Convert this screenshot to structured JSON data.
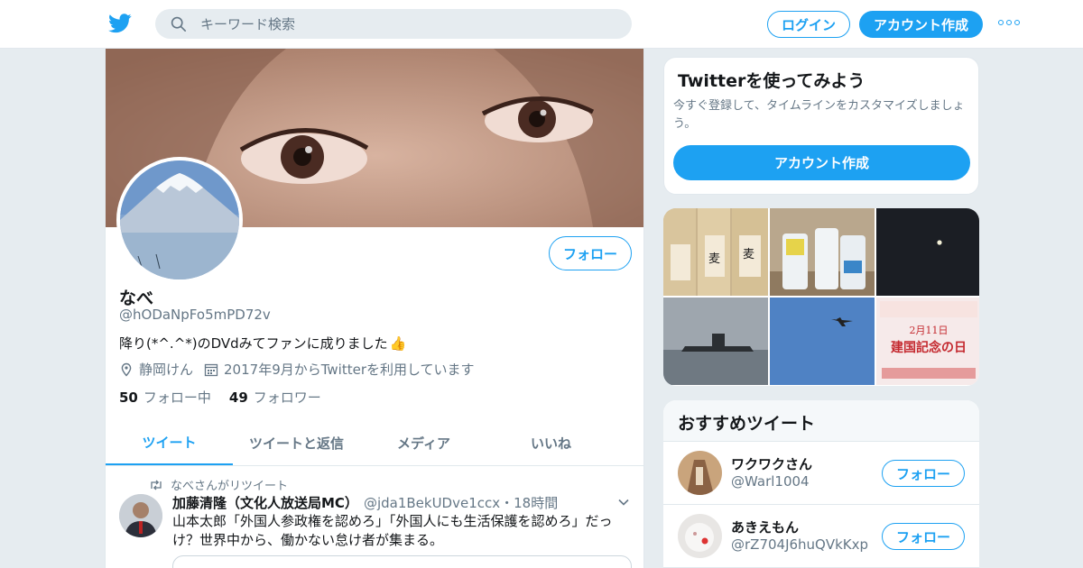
{
  "nav": {
    "search_placeholder": "キーワード検索",
    "login_label": "ログイン",
    "signup_label": "アカウント作成"
  },
  "profile": {
    "name": "なべ",
    "handle": "@hODaNpFo5mPD72v",
    "bio": "降り(*^.^*)のDVdみてファンに成りました",
    "bio_emoji": "👍",
    "location": "静岡けん",
    "joined": "2017年9月からTwitterを利用しています",
    "following_count": "50",
    "following_label": "フォロー中",
    "followers_count": "49",
    "followers_label": "フォロワー",
    "follow_button": "フォロー"
  },
  "tabs": [
    {
      "label": "ツイート",
      "active": true
    },
    {
      "label": "ツイートと返信",
      "active": false
    },
    {
      "label": "メディア",
      "active": false
    },
    {
      "label": "いいね",
      "active": false
    }
  ],
  "tweet": {
    "retweet_context": "なべさんがリツイート",
    "author_name": "加藤清隆（文化人放送局MC）",
    "author_handle": "@jda1BekUDve1ccx",
    "time": "・18時間",
    "text": "山本太郎「外国人参政権を認めろ」「外国人にも生活保護を認めろ」だっけ？世界中から、働かない怠け者が集まる。"
  },
  "signup_card": {
    "title": "Twitterを使ってみよう",
    "description": "今すぐ登録して、タイムラインをカスタマイズしましょう。",
    "button": "アカウント作成"
  },
  "who_to_follow": {
    "title": "おすすめツイート",
    "users": [
      {
        "name": "ワクワクさん",
        "handle": "@Warl1004",
        "button": "フォロー"
      },
      {
        "name": "あきえもん",
        "handle": "@rZ704J6huQVkKxp",
        "button": "フォロー"
      }
    ]
  },
  "colors": {
    "accent": "#1da1f2",
    "background": "#e6ecf0",
    "text_secondary": "#657786"
  }
}
